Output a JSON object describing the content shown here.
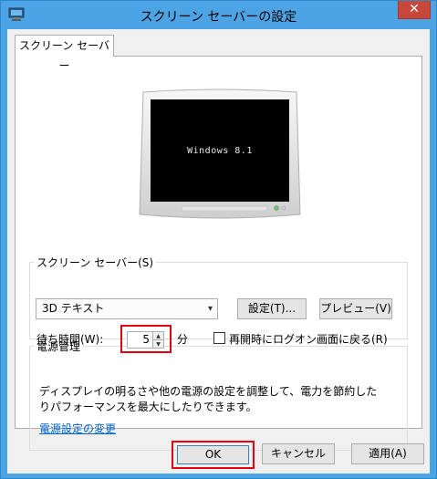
{
  "window": {
    "title": "スクリーン セーバーの設定",
    "close_glyph": "✕"
  },
  "tab": {
    "label": "スクリーン セーバー"
  },
  "monitor": {
    "preview_text": "Windows 8.1"
  },
  "screensaver_group": {
    "legend": "スクリーン セーバー(S)",
    "selected": "3D テキスト",
    "settings_button": "設定(T)...",
    "preview_button": "プレビュー(V)",
    "wait_label": "待ち時間(W):",
    "wait_value": "5",
    "wait_unit": "分",
    "logon_checkbox_label": "再開時にログオン画面に戻る(R)",
    "logon_checked": false
  },
  "power_group": {
    "legend": "電源管理",
    "description": "ディスプレイの明るさや他の電源の設定を調整して、電力を節約したりパフォーマンスを最大にしたりできます。",
    "link": "電源設定の変更"
  },
  "buttons": {
    "ok": "OK",
    "cancel": "キャンセル",
    "apply": "適用(A)"
  },
  "colors": {
    "titlebar": "#4ca4e4",
    "close": "#c7473a",
    "highlight": "#e60012",
    "link": "#0066cc"
  },
  "icons": {
    "app": "screen-saver-monitor-icon",
    "close": "close-icon",
    "dropdown": "chevron-down-icon",
    "spin_up": "triangle-up-icon",
    "spin_down": "triangle-down-icon"
  }
}
